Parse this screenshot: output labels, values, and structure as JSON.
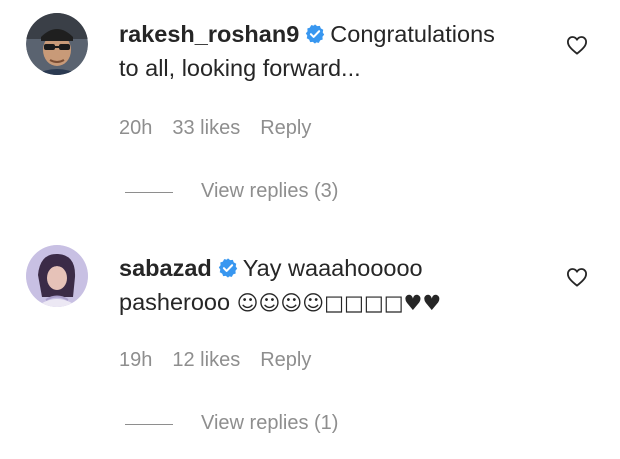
{
  "comments": [
    {
      "username": "rakesh_roshan9",
      "verified": true,
      "text_line1": "Congratulations",
      "text_line2": "to all, looking forward...",
      "time": "20h",
      "likes": "33 likes",
      "reply": "Reply",
      "view_replies": "View replies (3)"
    },
    {
      "username": "sabazad",
      "verified": true,
      "text_line1": "Yay waaahooooo",
      "text_line2_word": "pasherooo",
      "text_line2_emoji": "☺☺☺☺□□□□♥♥",
      "time": "19h",
      "likes": "12 likes",
      "reply": "Reply",
      "view_replies": "View replies (1)"
    }
  ],
  "colors": {
    "text": "#262626",
    "secondary": "#8e8e8e",
    "verified_badge": "#3897f0"
  },
  "icons": {
    "verified": "verified-badge-icon",
    "like": "heart-outline-icon"
  }
}
